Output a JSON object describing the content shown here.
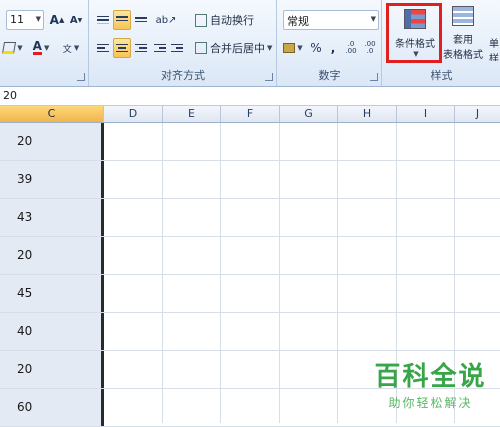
{
  "ribbon": {
    "font": {
      "size": "11",
      "grow_icon": "A",
      "shrink_icon": "A"
    },
    "alignment": {
      "wrap_text": "自动换行",
      "merge_center": "合并后居中",
      "group_label": "对齐方式"
    },
    "number": {
      "format": "常规",
      "percent": "%",
      "comma": ",",
      "inc_decimal": ".0 .00",
      "dec_decimal": ".00 .0",
      "group_label": "数字"
    },
    "styles": {
      "conditional_format": "条件格式",
      "table_format_top": "套用",
      "table_format_bottom": "表格格式",
      "cell_style_top": "单",
      "cell_style_bottom": "样",
      "group_label": "样式"
    }
  },
  "formula_bar": {
    "value": "20"
  },
  "columns": [
    "C",
    "D",
    "E",
    "F",
    "G",
    "H",
    "I",
    "J"
  ],
  "selected_column": "C",
  "cells_c": [
    "20",
    "39",
    "43",
    "20",
    "45",
    "40",
    "20",
    "60"
  ],
  "watermark": {
    "title": "百科全说",
    "subtitle": "助你轻松解决"
  },
  "colors": {
    "highlight": "#e02020",
    "selection": "#e4eaf4",
    "watermark": "#37a548"
  }
}
